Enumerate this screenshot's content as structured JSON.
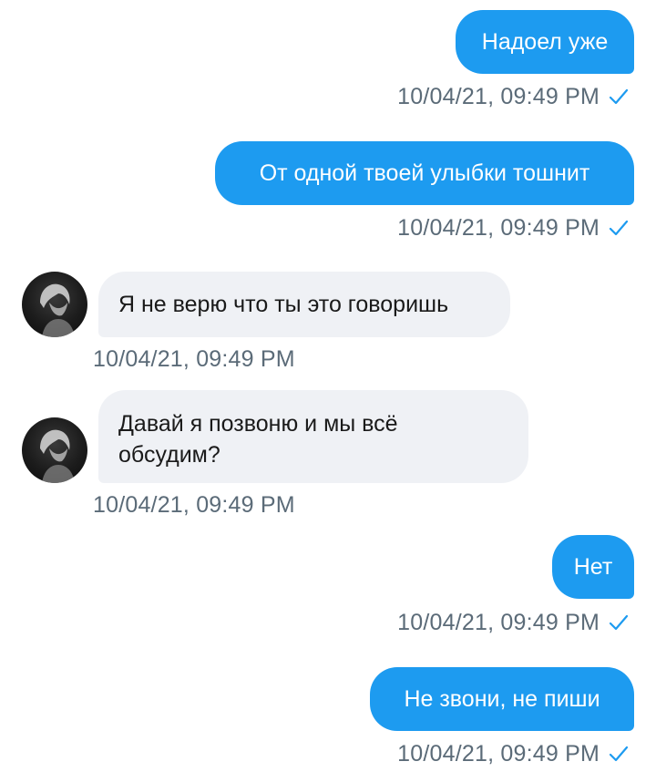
{
  "messages": [
    {
      "direction": "outgoing",
      "text": "Надоел уже",
      "time": "10/04/21, 09:49 PM",
      "status": "sent"
    },
    {
      "direction": "outgoing",
      "text": "От одной твоей улыбки тошнит",
      "time": "10/04/21, 09:49 PM",
      "status": "sent"
    },
    {
      "direction": "incoming",
      "text": "Я не верю что ты это говоришь",
      "time": "10/04/21, 09:49 PM"
    },
    {
      "direction": "incoming",
      "text": "Давай я позвоню и мы всё обсудим?",
      "time": "10/04/21, 09:49 PM"
    },
    {
      "direction": "outgoing",
      "text": "Нет",
      "time": "10/04/21, 09:49 PM",
      "status": "sent"
    },
    {
      "direction": "outgoing",
      "text": "Не звони, не пиши",
      "time": "10/04/21, 09:49 PM",
      "status": "sent"
    }
  ],
  "icons": {
    "check": "check-icon",
    "avatar": "contact-avatar"
  },
  "colors": {
    "outgoing_bubble": "#1d9bf0",
    "incoming_bubble": "#eff1f5",
    "timestamp": "#5b6b78",
    "check": "#1d9bf0"
  }
}
